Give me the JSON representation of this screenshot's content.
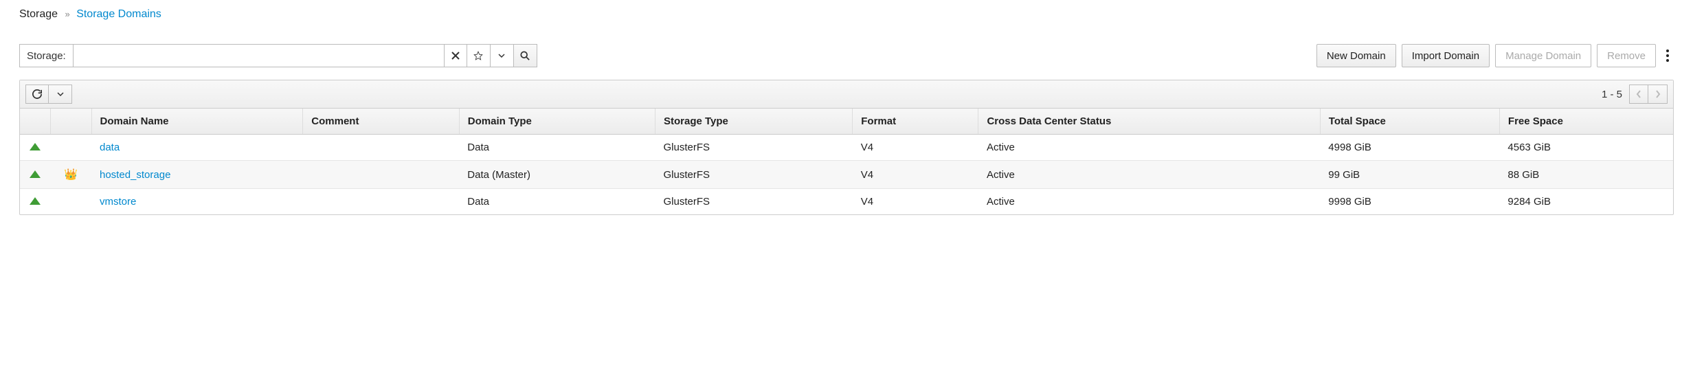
{
  "breadcrumb": {
    "root": "Storage",
    "current": "Storage Domains"
  },
  "search": {
    "label": "Storage:",
    "value": ""
  },
  "actions": {
    "new_domain": "New Domain",
    "import_domain": "Import Domain",
    "manage_domain": "Manage Domain",
    "remove": "Remove"
  },
  "pager": {
    "range": "1 - 5"
  },
  "columns": {
    "status": "",
    "icon": "",
    "domain_name": "Domain Name",
    "comment": "Comment",
    "domain_type": "Domain Type",
    "storage_type": "Storage Type",
    "format": "Format",
    "cross_dc_status": "Cross Data Center Status",
    "total_space": "Total Space",
    "free_space": "Free Space"
  },
  "rows": [
    {
      "status": "up",
      "crown": false,
      "domain_name": "data",
      "comment": "",
      "domain_type": "Data",
      "storage_type": "GlusterFS",
      "format": "V4",
      "cross_dc_status": "Active",
      "total_space": "4998 GiB",
      "free_space": "4563 GiB"
    },
    {
      "status": "up",
      "crown": true,
      "domain_name": "hosted_storage",
      "comment": "",
      "domain_type": "Data (Master)",
      "storage_type": "GlusterFS",
      "format": "V4",
      "cross_dc_status": "Active",
      "total_space": "99 GiB",
      "free_space": "88 GiB"
    },
    {
      "status": "up",
      "crown": false,
      "domain_name": "vmstore",
      "comment": "",
      "domain_type": "Data",
      "storage_type": "GlusterFS",
      "format": "V4",
      "cross_dc_status": "Active",
      "total_space": "9998 GiB",
      "free_space": "9284 GiB"
    }
  ]
}
